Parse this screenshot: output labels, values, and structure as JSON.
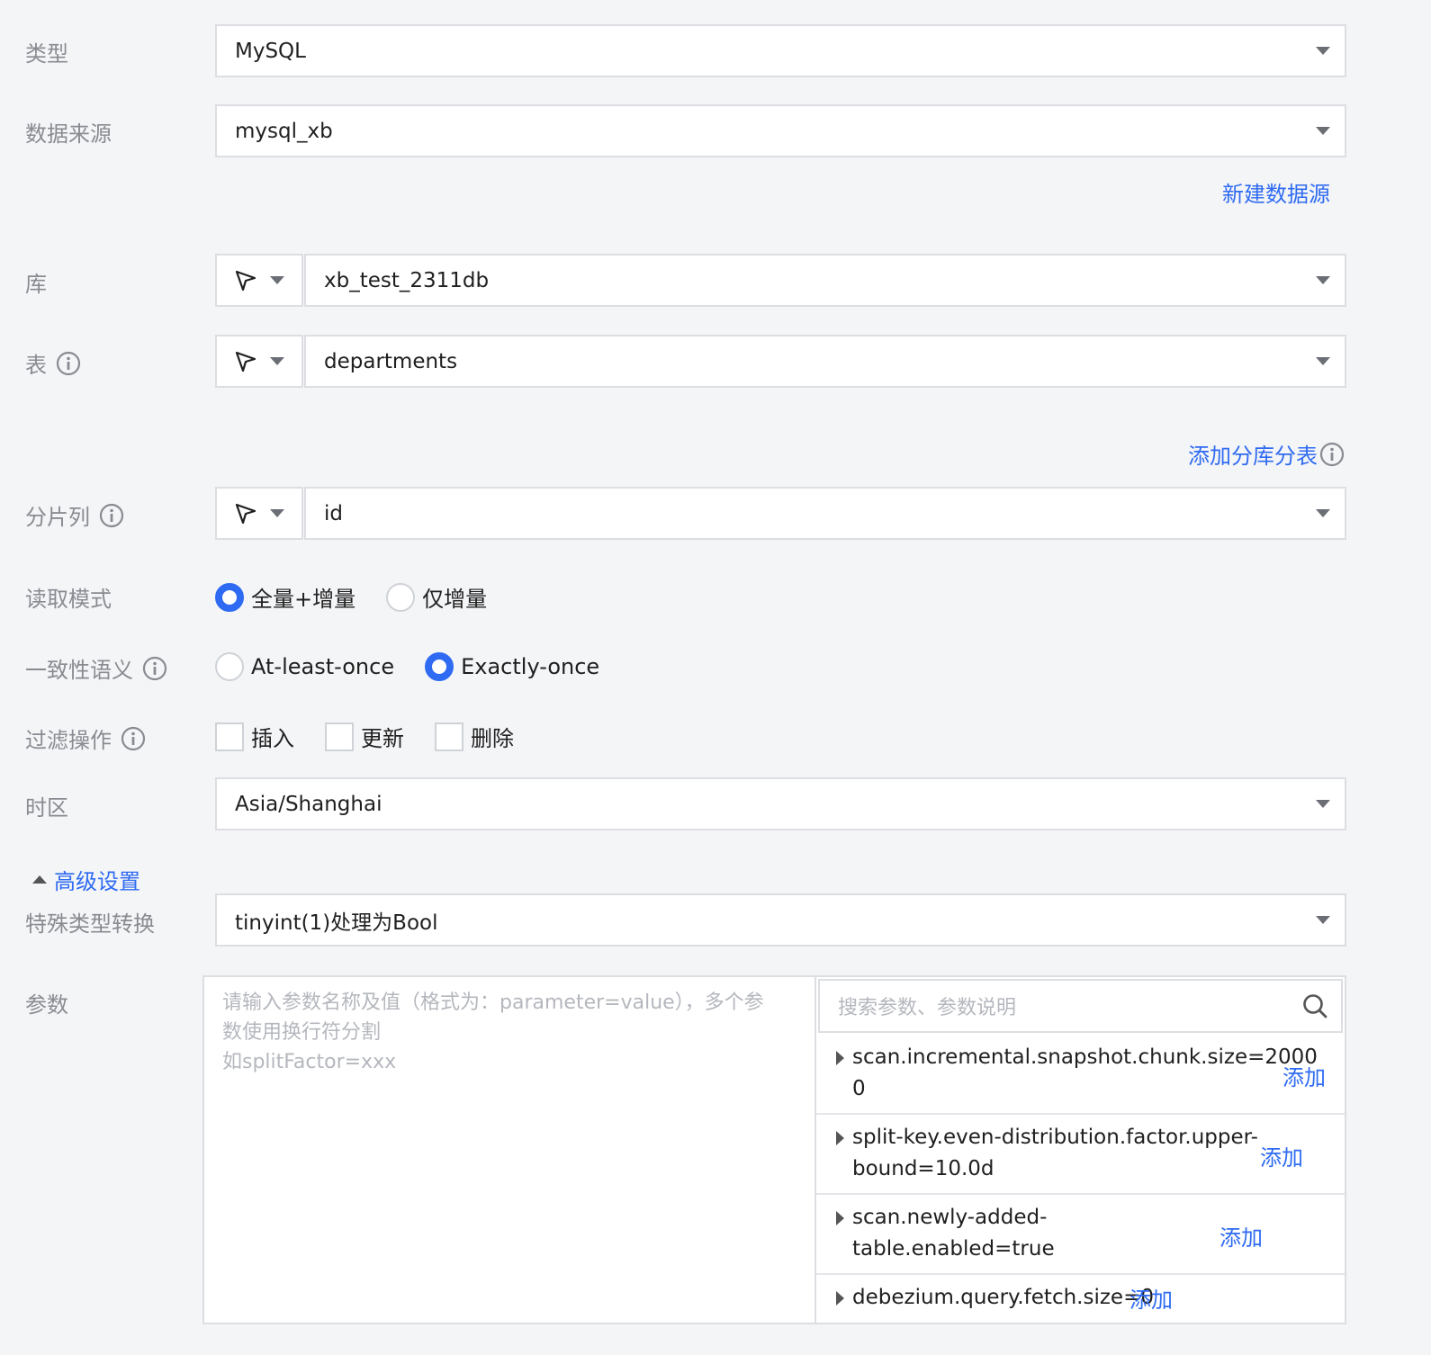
{
  "fields": {
    "type": {
      "label": "类型",
      "value": "MySQL"
    },
    "source": {
      "label": "数据来源",
      "value": "mysql_xb",
      "new_link": "新建数据源"
    },
    "database": {
      "label": "库",
      "value": "xb_test_2311db"
    },
    "table": {
      "label": "表",
      "value": "departments",
      "shard_link": "添加分库分表"
    },
    "shard_column": {
      "label": "分片列",
      "value": "id"
    },
    "read_mode": {
      "label": "读取模式",
      "options": [
        "全量+增量",
        "仅增量"
      ],
      "selected": "全量+增量"
    },
    "consistency": {
      "label": "一致性语义",
      "options": [
        "At-least-once",
        "Exactly-once"
      ],
      "selected": "Exactly-once"
    },
    "filter_ops": {
      "label": "过滤操作",
      "options": [
        "插入",
        "更新",
        "删除"
      ]
    },
    "timezone": {
      "label": "时区",
      "value": "Asia/Shanghai"
    },
    "advanced": {
      "toggle": "高级设置"
    },
    "special_conversion": {
      "label": "特殊类型转换",
      "value": "tinyint(1)处理为Bool"
    },
    "params": {
      "label": "参数",
      "placeholder": "请输入参数名称及值（格式为：parameter=value），多个参\n数使用换行符分割\n如splitFactor=xxx",
      "search_placeholder": "搜索参数、参数说明",
      "add_label": "添加",
      "items": [
        {
          "line1": "scan.incremental.snapshot.chunk.size=2000",
          "line2": "0"
        },
        {
          "line1": "split-key.even-distribution.factor.upper-",
          "line2": "bound=10.0d"
        },
        {
          "line1": "scan.newly-added-",
          "line2": "table.enabled=true"
        },
        {
          "line1": "debezium.query.fetch.size=0",
          "line2": ""
        }
      ]
    }
  },
  "colors": {
    "accent": "#2f6bf2",
    "label": "#888b91",
    "border": "#dcdee2"
  }
}
